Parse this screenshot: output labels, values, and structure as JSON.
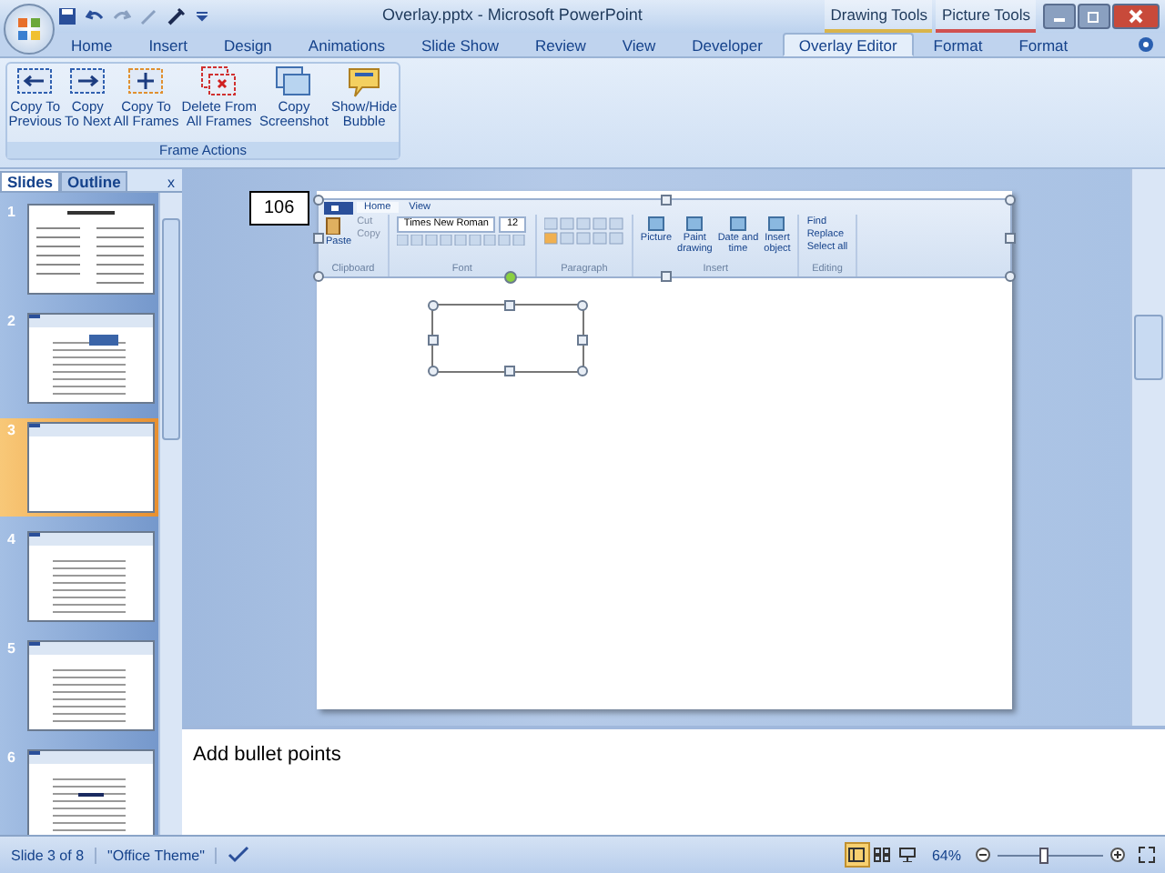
{
  "window": {
    "title": "Overlay.pptx - Microsoft PowerPoint"
  },
  "context_tabs": [
    {
      "label": "Drawing Tools",
      "color": "#d9b44a"
    },
    {
      "label": "Picture Tools",
      "color": "#d05050"
    }
  ],
  "tabs": [
    {
      "label": "Home",
      "selected": false
    },
    {
      "label": "Insert",
      "selected": false
    },
    {
      "label": "Design",
      "selected": false
    },
    {
      "label": "Animations",
      "selected": false
    },
    {
      "label": "Slide Show",
      "selected": false
    },
    {
      "label": "Review",
      "selected": false
    },
    {
      "label": "View",
      "selected": false
    },
    {
      "label": "Developer",
      "selected": false
    },
    {
      "label": "Overlay Editor",
      "selected": true
    },
    {
      "label": "Format",
      "selected": false
    },
    {
      "label": "Format",
      "selected": false
    }
  ],
  "ribbon": {
    "group": "Frame Actions",
    "buttons": [
      {
        "label": "Copy To\nPrevious",
        "kind": "prev"
      },
      {
        "label": "Copy\nTo Next",
        "kind": "next"
      },
      {
        "label": "Copy To\nAll Frames",
        "kind": "all"
      },
      {
        "label": "Delete From\nAll Frames",
        "kind": "delete"
      },
      {
        "label": "Copy\nScreenshot",
        "kind": "screenshot"
      },
      {
        "label": "Show/Hide\nBubble",
        "kind": "bubble"
      }
    ]
  },
  "slides_pane": {
    "tabs": [
      {
        "label": "Slides",
        "selected": true
      },
      {
        "label": "Outline",
        "selected": false
      }
    ],
    "close": "x",
    "thumbnails": [
      {
        "number": "1",
        "kind": "text",
        "selected": false
      },
      {
        "number": "2",
        "kind": "callout",
        "selected": false
      },
      {
        "number": "3",
        "kind": "blank",
        "selected": true
      },
      {
        "number": "4",
        "kind": "document",
        "selected": false
      },
      {
        "number": "5",
        "kind": "document",
        "selected": false
      },
      {
        "number": "6",
        "kind": "highlight",
        "selected": false
      }
    ]
  },
  "slide": {
    "frame_number": "106",
    "screenshot": {
      "tabs": [
        {
          "label": "Home",
          "selected": true
        },
        {
          "label": "View",
          "selected": false
        }
      ],
      "clipboard": {
        "paste": "Paste",
        "cut": "Cut",
        "copy": "Copy",
        "label": "Clipboard"
      },
      "font": {
        "name": "Times New Roman",
        "size": "12",
        "label": "Font"
      },
      "paragraph": {
        "label": "Paragraph"
      },
      "insert": {
        "items": [
          "Picture",
          "Paint\ndrawing",
          "Date and\ntime",
          "Insert\nobject"
        ],
        "label": "Insert"
      },
      "editing": {
        "items": [
          "Find",
          "Replace",
          "Select all"
        ],
        "label": "Editing"
      }
    }
  },
  "notes": {
    "text": "Add bullet points"
  },
  "status_bar": {
    "slide": "Slide 3 of 8",
    "theme": "\"Office Theme\"",
    "views": [
      {
        "kind": "normal",
        "selected": true
      },
      {
        "kind": "sorter",
        "selected": false
      },
      {
        "kind": "show",
        "selected": false
      }
    ],
    "zoom": "64%",
    "zoom_slider": {
      "level": 0.45
    }
  }
}
